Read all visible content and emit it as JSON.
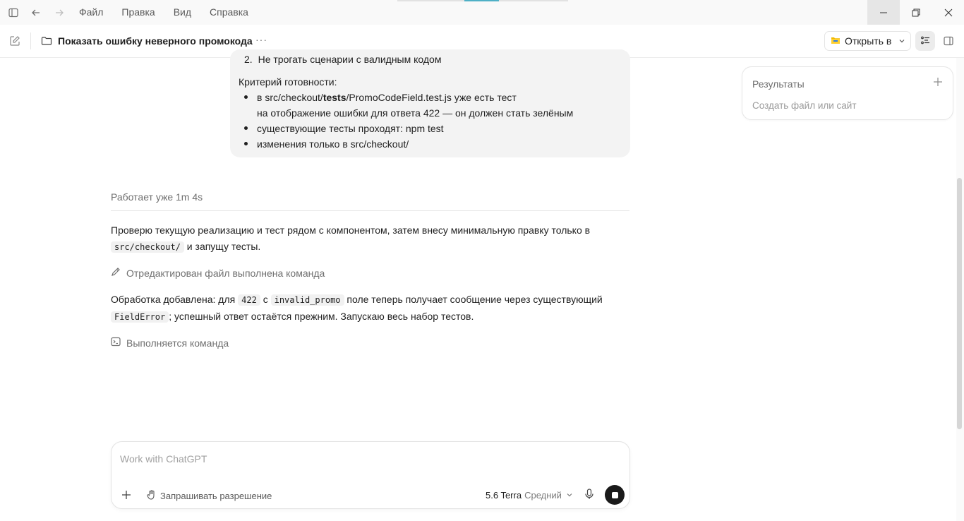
{
  "menu": [
    "Файл",
    "Правка",
    "Вид",
    "Справка"
  ],
  "header": {
    "title": "Показать ошибку неверного промокода",
    "more": "···",
    "open_label": "Открыть в"
  },
  "bubble": {
    "list_item_2_num": "2.",
    "list_item_2": "Не трогать сценарии с валидным кодом",
    "criteria_heading": "Критерий готовности:",
    "c1_prefix": "в src/checkout/",
    "c1_bold": "tests",
    "c1_suffix": "/PromoCodeField.test.js уже есть тест",
    "c1_line2": "на отображение ошибки для ответа 422 — он должен стать зелёным",
    "c2": "существующие тесты проходят: npm test",
    "c3": "изменения только в src/checkout/"
  },
  "status": "Работает уже 1m 4s",
  "msg1": {
    "text_a": "Проверю текущую реализацию и тест рядом с компонентом, затем внесу минимальную правку только в",
    "code": "src/checkout/",
    "text_b": " и запущу тесты."
  },
  "action1": "Отредактирован файл выполнена команда",
  "msg2": {
    "text_a": "Обработка добавлена: для ",
    "code1": "422",
    "text_b": " с ",
    "code2": "invalid_promo",
    "text_c": " поле теперь получает сообщение через существующий",
    "code3": "FieldError",
    "text_d": "; успешный ответ остаётся прежним. Запускаю весь набор тестов."
  },
  "action2": "Выполняется команда",
  "results": {
    "title": "Результаты",
    "subtitle": "Создать файл или сайт"
  },
  "composer": {
    "placeholder": "Work with ChatGPT",
    "permission": "Запрашивать разрешение",
    "model": "5.6 Terra",
    "level": "Средний"
  },
  "colors": {
    "accent_strip": "#4fb0c6",
    "bubble_bg": "#f3f3f3",
    "stop_btn": "#1a1a1a"
  }
}
